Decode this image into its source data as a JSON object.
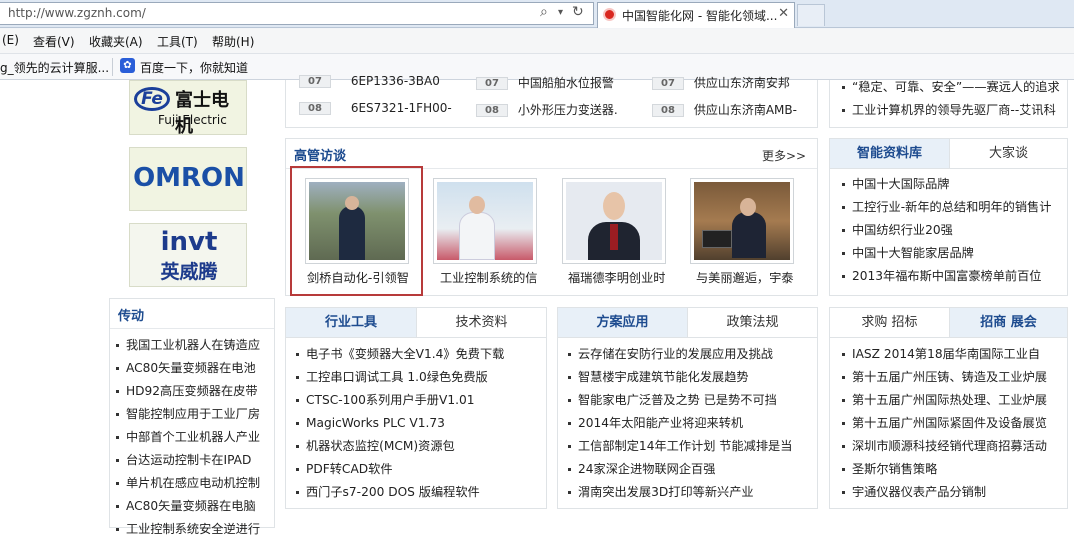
{
  "browser": {
    "url": "http://www.zgznh.com/",
    "tab_title": "中国智能化网 - 智能化领域...",
    "menu": [
      "(E)",
      "查看(V)",
      "收藏夹(A)",
      "工具(T)",
      "帮助(H)"
    ],
    "favorites": [
      "g_领先的云计算服...",
      "百度一下，你就知道"
    ]
  },
  "logos": {
    "fuji_cn": "富士电机",
    "fuji_en": "Fuji Electric",
    "omron": "OMRON",
    "invt": "invt",
    "invt_cn": "英威腾"
  },
  "top_list": {
    "rows": [
      {
        "n1": "07",
        "t1": "6EP1336-3BA0",
        "n2": "07",
        "t2": "中国船舶水位报警",
        "n3": "07",
        "t3": "供应山东济南安邦"
      },
      {
        "n1": "08",
        "t1": "6ES7321-1FH00-",
        "n2": "08",
        "t2": "小外形压力变送器.",
        "n3": "08",
        "t3": "供应山东济南AMB-"
      }
    ],
    "right": [
      "“稳定、可靠、安全”——赛远人的追求",
      "工业计算机界的领导先驱厂商--艾讯科"
    ]
  },
  "interviews": {
    "title": "高管访谈",
    "more": "更多>>",
    "items": [
      "剑桥自动化-引领智",
      "工业控制系统的信",
      "福瑞德李明创业时",
      "与美丽邂逅，宇泰"
    ]
  },
  "knowledge": {
    "tab_on": "智能资料库",
    "tab_off": "大家谈",
    "items": [
      "中国十大国际品牌",
      "工控行业-新年的总结和明年的销售计",
      "中国纺织行业20强",
      "中国十大智能家居品牌",
      "2013年福布斯中国富豪榜单前百位"
    ]
  },
  "chuandong": {
    "title": "传动",
    "items": [
      "我国工业机器人在铸造应",
      "AC80矢量变频器在电池",
      "HD92高压变频器在皮带",
      "智能控制应用于工业厂房",
      "中部首个工业机器人产业",
      "台达运动控制卡在IPAD",
      "单片机在感应电动机控制",
      "AC80矢量变频器在电脑",
      "工业控制系统安全逆进行"
    ]
  },
  "tools": {
    "tab_on": "行业工具",
    "tab_off": "技术资料",
    "items": [
      "电子书《变频器大全V1.4》免费下载",
      "工控串口调试工具 1.0绿色免费版",
      "CTSC-100系列用户手册V1.01",
      "MagicWorks PLC V1.73",
      "机器状态监控(MCM)资源包",
      "PDF转CAD软件",
      "西门子s7-200 DOS 版编程软件"
    ]
  },
  "solutions": {
    "tab_on": "方案应用",
    "tab_off": "政策法规",
    "items": [
      "云存储在安防行业的发展应用及挑战",
      "智慧楼宇成建筑节能化发展趋势",
      "智能家电广泛普及之势 已是势不可挡",
      "2014年太阳能产业将迎来转机",
      "工信部制定14年工作计划 节能减排是当",
      "24家深企进物联网企百强",
      "渭南突出发展3D打印等新兴产业"
    ]
  },
  "exhibit": {
    "tab_off": "求购 招标",
    "tab_on": "招商 展会",
    "items": [
      "IASZ 2014第18届华南国际工业自",
      "第十五届广州压铸、铸造及工业炉展",
      "第十五届广州国际热处理、工业炉展",
      "第十五届广州国际紧固件及设备展览",
      "深圳市顺源科技经销代理商招募活动",
      "圣斯尔销售策略",
      "宇通仪器仪表产品分销制"
    ]
  }
}
